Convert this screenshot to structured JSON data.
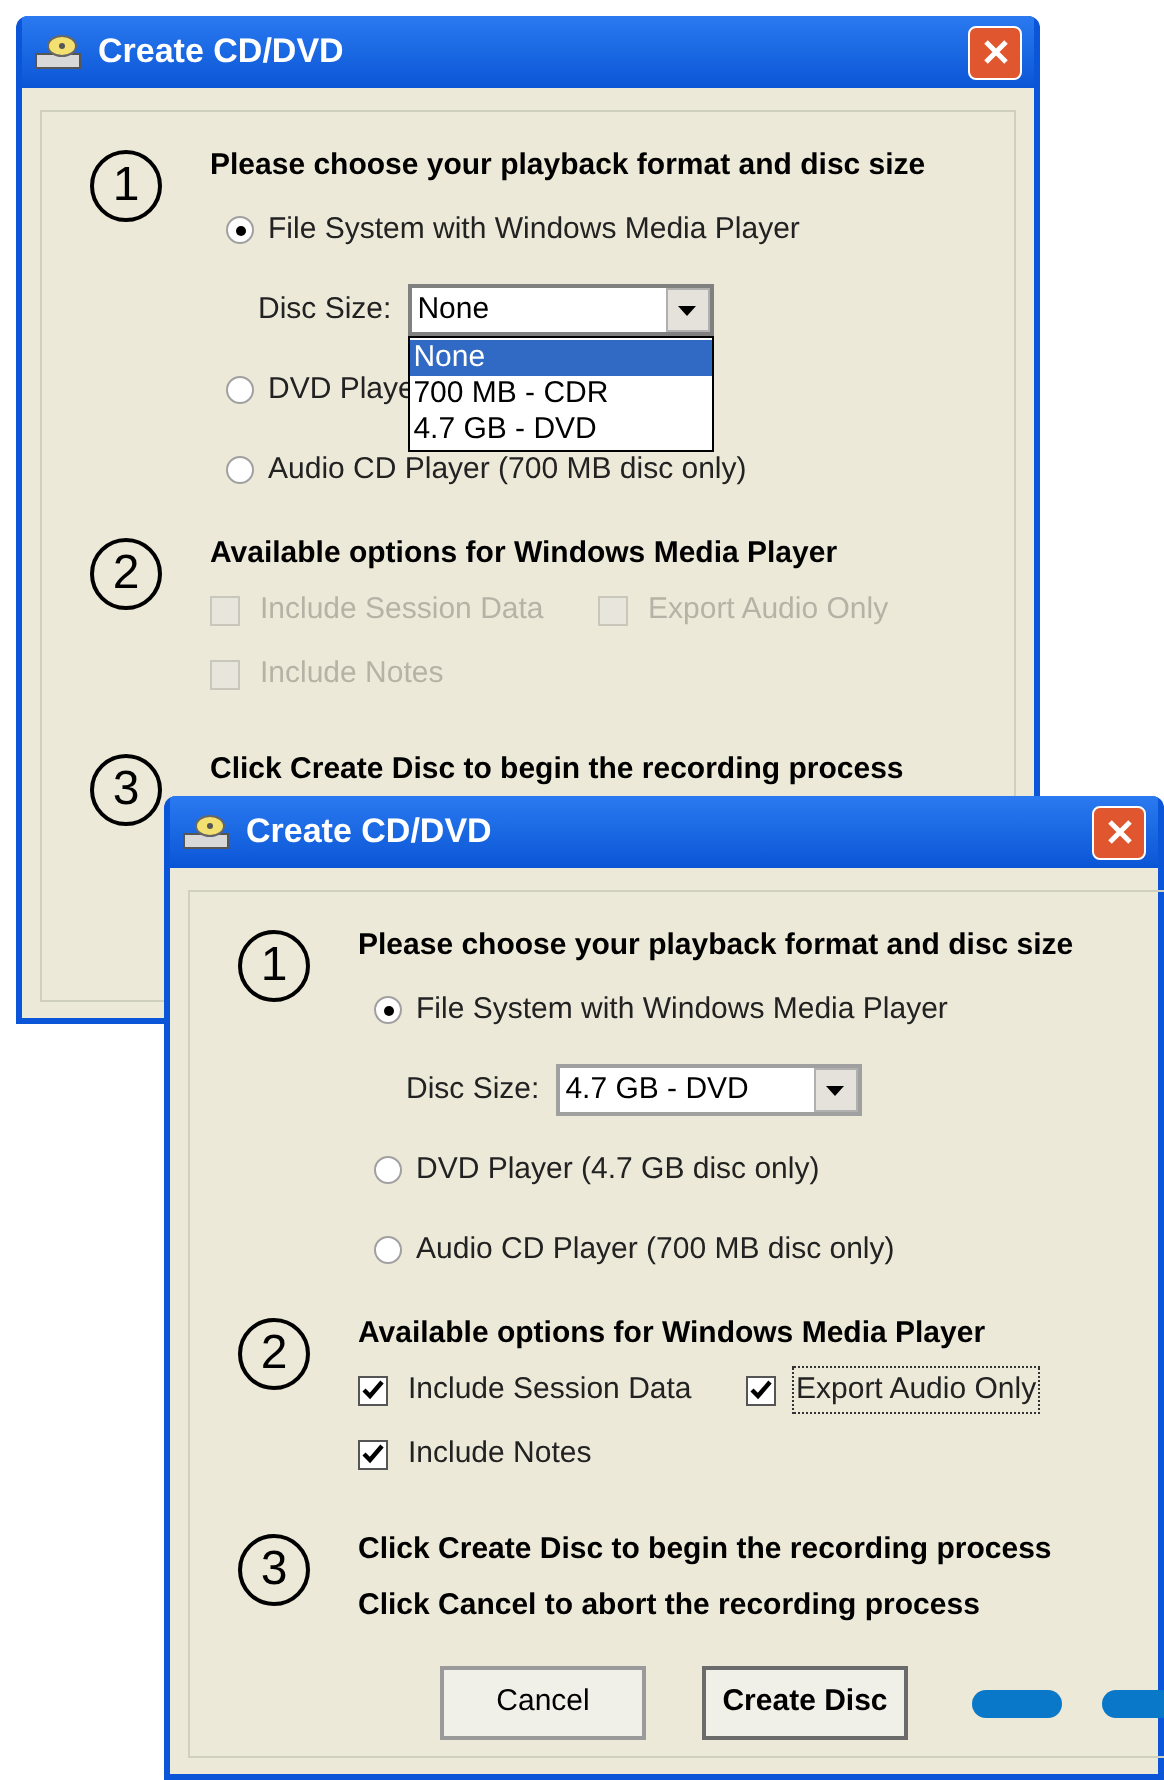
{
  "windows": [
    {
      "title": "Create CD/DVD",
      "sections": [
        {
          "number": "1",
          "heading": "Please choose your playback format and disc size",
          "items": [
            {
              "kind": "radio",
              "label": "File System with Windows Media Player",
              "selected": true
            },
            {
              "kind": "combo",
              "label": "Disc Size:",
              "value": "None",
              "expanded": true,
              "options": [
                {
                  "label": "None",
                  "selected": true
                },
                {
                  "label": "700 MB - CDR",
                  "selected": false
                },
                {
                  "label": "4.7 GB - DVD",
                  "selected": false
                }
              ]
            },
            {
              "kind": "radio",
              "label": "DVD Playe",
              "selected": false
            },
            {
              "kind": "radio",
              "label": "Audio CD Player (700 MB disc only)",
              "selected": false
            }
          ]
        },
        {
          "number": "2",
          "heading": "Available options for Windows Media Player",
          "rows": [
            [
              {
                "label": "Include Session Data",
                "checked": false,
                "disabled": true,
                "focused": false
              },
              {
                "label": "Export Audio Only",
                "checked": false,
                "disabled": true,
                "focused": false
              }
            ],
            [
              {
                "label": "Include Notes",
                "checked": false,
                "disabled": true,
                "focused": false
              }
            ]
          ]
        },
        {
          "number": "3",
          "lines": [
            "Click Create Disc to begin the recording process"
          ]
        }
      ]
    },
    {
      "title": "Create CD/DVD",
      "sections": [
        {
          "number": "1",
          "heading": "Please choose your playback format and disc size",
          "items": [
            {
              "kind": "radio",
              "label": "File System with Windows Media Player",
              "selected": true
            },
            {
              "kind": "combo",
              "label": "Disc Size:",
              "value": "4.7 GB - DVD",
              "expanded": false
            },
            {
              "kind": "radio",
              "label": "DVD Player (4.7 GB disc only)",
              "selected": false
            },
            {
              "kind": "radio",
              "label": "Audio CD Player (700 MB disc only)",
              "selected": false
            }
          ]
        },
        {
          "number": "2",
          "heading": "Available options for Windows Media Player",
          "rows": [
            [
              {
                "label": "Include Session Data",
                "checked": true,
                "disabled": false,
                "focused": false
              },
              {
                "label": "Export Audio Only",
                "checked": true,
                "disabled": false,
                "focused": true
              }
            ],
            [
              {
                "label": "Include Notes",
                "checked": true,
                "disabled": false,
                "focused": false
              }
            ]
          ]
        },
        {
          "number": "3",
          "lines": [
            "Click Create Disc to begin the recording process",
            "Click Cancel to abort the recording process"
          ],
          "buttons": [
            {
              "label": "Cancel",
              "default": false
            },
            {
              "label": "Create Disc",
              "default": true
            }
          ]
        }
      ]
    }
  ]
}
